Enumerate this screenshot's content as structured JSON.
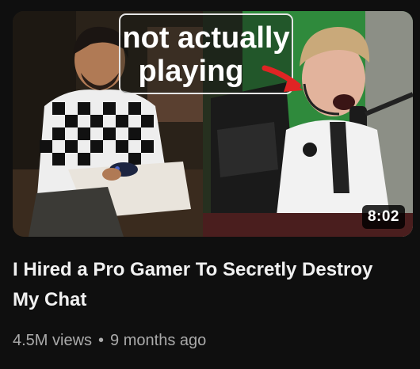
{
  "video": {
    "thumbnail_caption_line1": "not actually",
    "thumbnail_caption_line2": "playing",
    "duration": "8:02",
    "title": "I Hired a Pro Gamer To Secretly Destroy My Chat",
    "views": "4.5M views",
    "separator": "•",
    "age": "9 months ago"
  },
  "colors": {
    "background": "#0f0f0f",
    "title": "#f1f1f1",
    "meta": "#aaaaaa",
    "arrow": "#e02424",
    "greenscreen": "#2f8a3c"
  }
}
